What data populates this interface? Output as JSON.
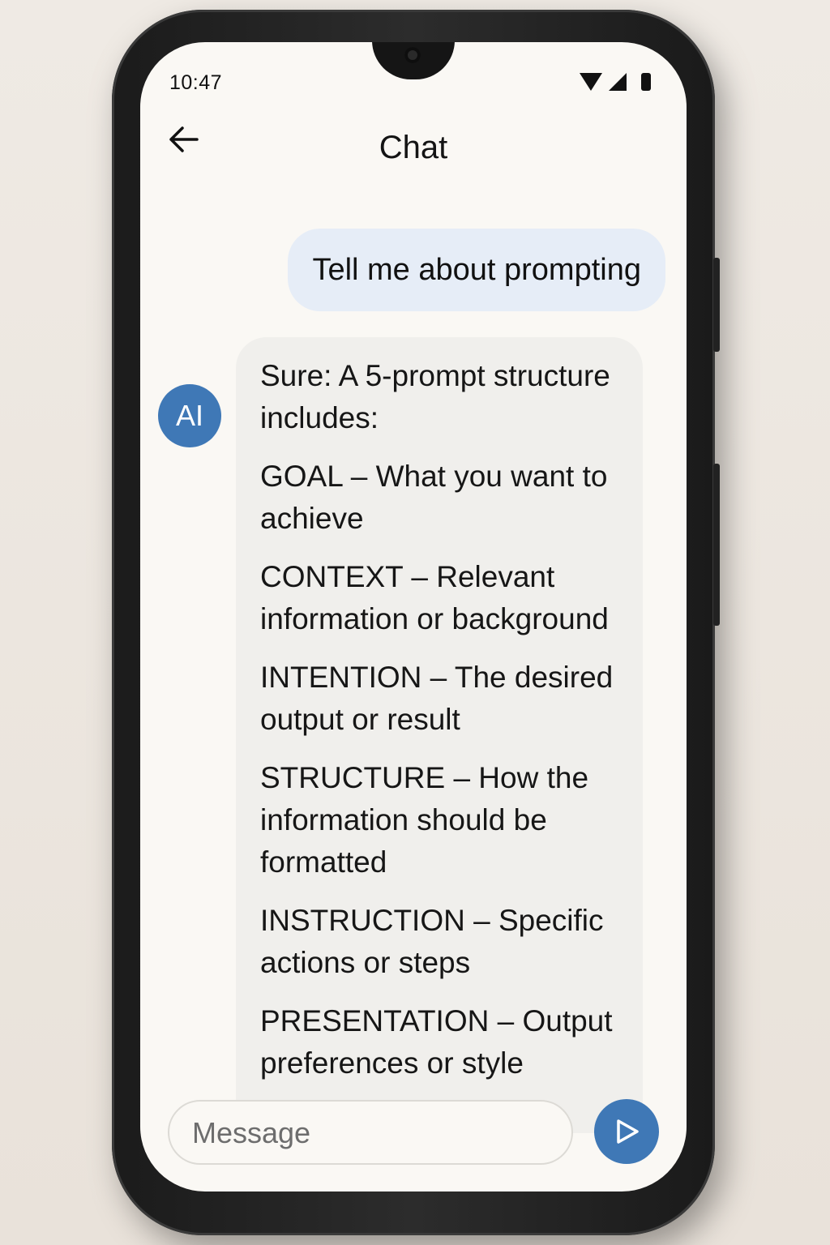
{
  "status_bar": {
    "time": "10:47",
    "icons": [
      "wifi-icon",
      "signal-icon",
      "battery-icon"
    ]
  },
  "header": {
    "back_icon": "arrow-left-icon",
    "title": "Chat"
  },
  "messages": {
    "user": {
      "text": "Tell me about prompting"
    },
    "ai": {
      "avatar_label": "AI",
      "intro": "Sure: A 5-prompt structure includes:",
      "items": [
        "GOAL – What you want to achieve",
        "CONTEXT – Relevant information or background",
        "INTENTION – The desired output or result",
        "STRUCTURE – How the information should be formatted",
        "INSTRUCTION – Specific actions or steps",
        "PRESENTATION – Output preferences or style"
      ]
    }
  },
  "composer": {
    "placeholder": "Message",
    "value": "",
    "send_icon": "send-icon"
  },
  "colors": {
    "accent": "#3f78b6",
    "user_bubble": "#e6edf7",
    "ai_bubble": "#f0efec",
    "screen_bg": "#faf8f4"
  }
}
